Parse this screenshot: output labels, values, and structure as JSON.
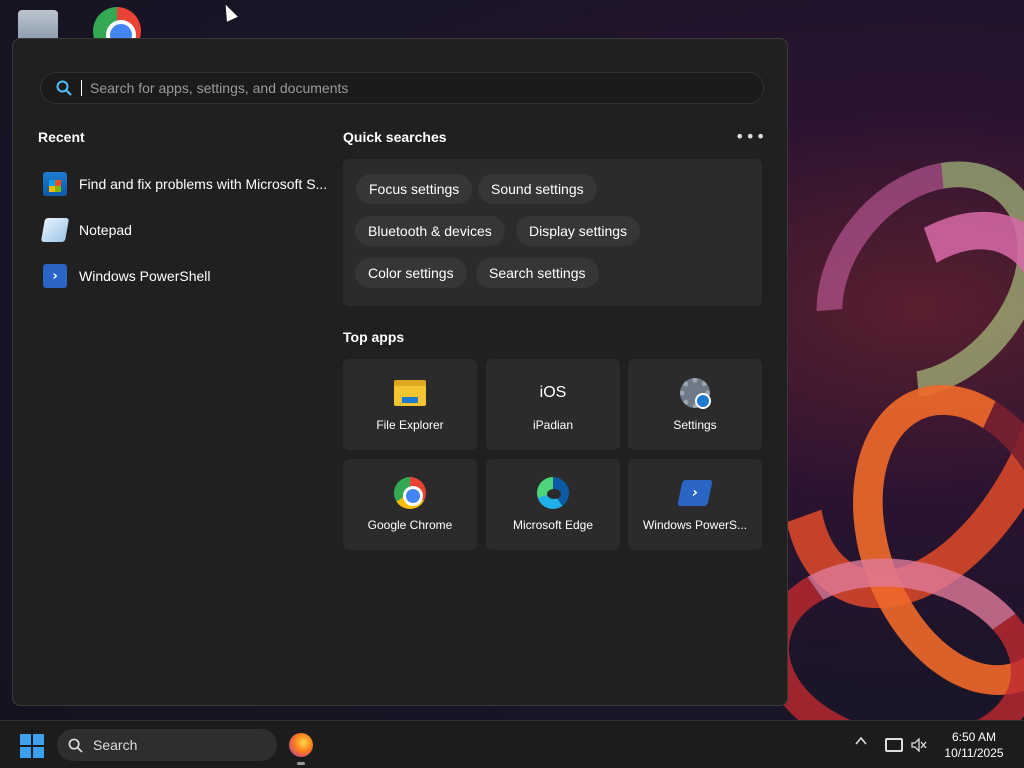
{
  "search": {
    "placeholder": "Search for apps, settings, and documents"
  },
  "recent": {
    "title": "Recent",
    "items": [
      {
        "label": "Find and fix problems with Microsoft S...",
        "icon": "store-troubleshooter-icon"
      },
      {
        "label": "Notepad",
        "icon": "notepad-icon"
      },
      {
        "label": "Windows PowerShell",
        "icon": "powershell-icon"
      }
    ]
  },
  "quick_searches": {
    "title": "Quick searches",
    "more_label": "•••",
    "chips": [
      "Focus settings",
      "Sound settings",
      "Bluetooth & devices",
      "Display settings",
      "Color settings",
      "Search settings"
    ]
  },
  "top_apps": {
    "title": "Top apps",
    "apps": [
      {
        "label": "File Explorer",
        "icon": "folder-icon"
      },
      {
        "label": "iPadian",
        "icon": "ipadian-icon",
        "glyph": "iOS"
      },
      {
        "label": "Settings",
        "icon": "gear-icon"
      },
      {
        "label": "Google Chrome",
        "icon": "chrome-icon"
      },
      {
        "label": "Microsoft Edge",
        "icon": "edge-icon"
      },
      {
        "label": "Windows PowerS...",
        "icon": "powershell-icon"
      }
    ]
  },
  "taskbar": {
    "search_label": "Search",
    "time": "6:50 AM",
    "date": "10/11/2025"
  },
  "colors": {
    "panel_bg": "#202020",
    "tile_bg": "#2b2b2b",
    "accent": "#3aa0ef"
  }
}
